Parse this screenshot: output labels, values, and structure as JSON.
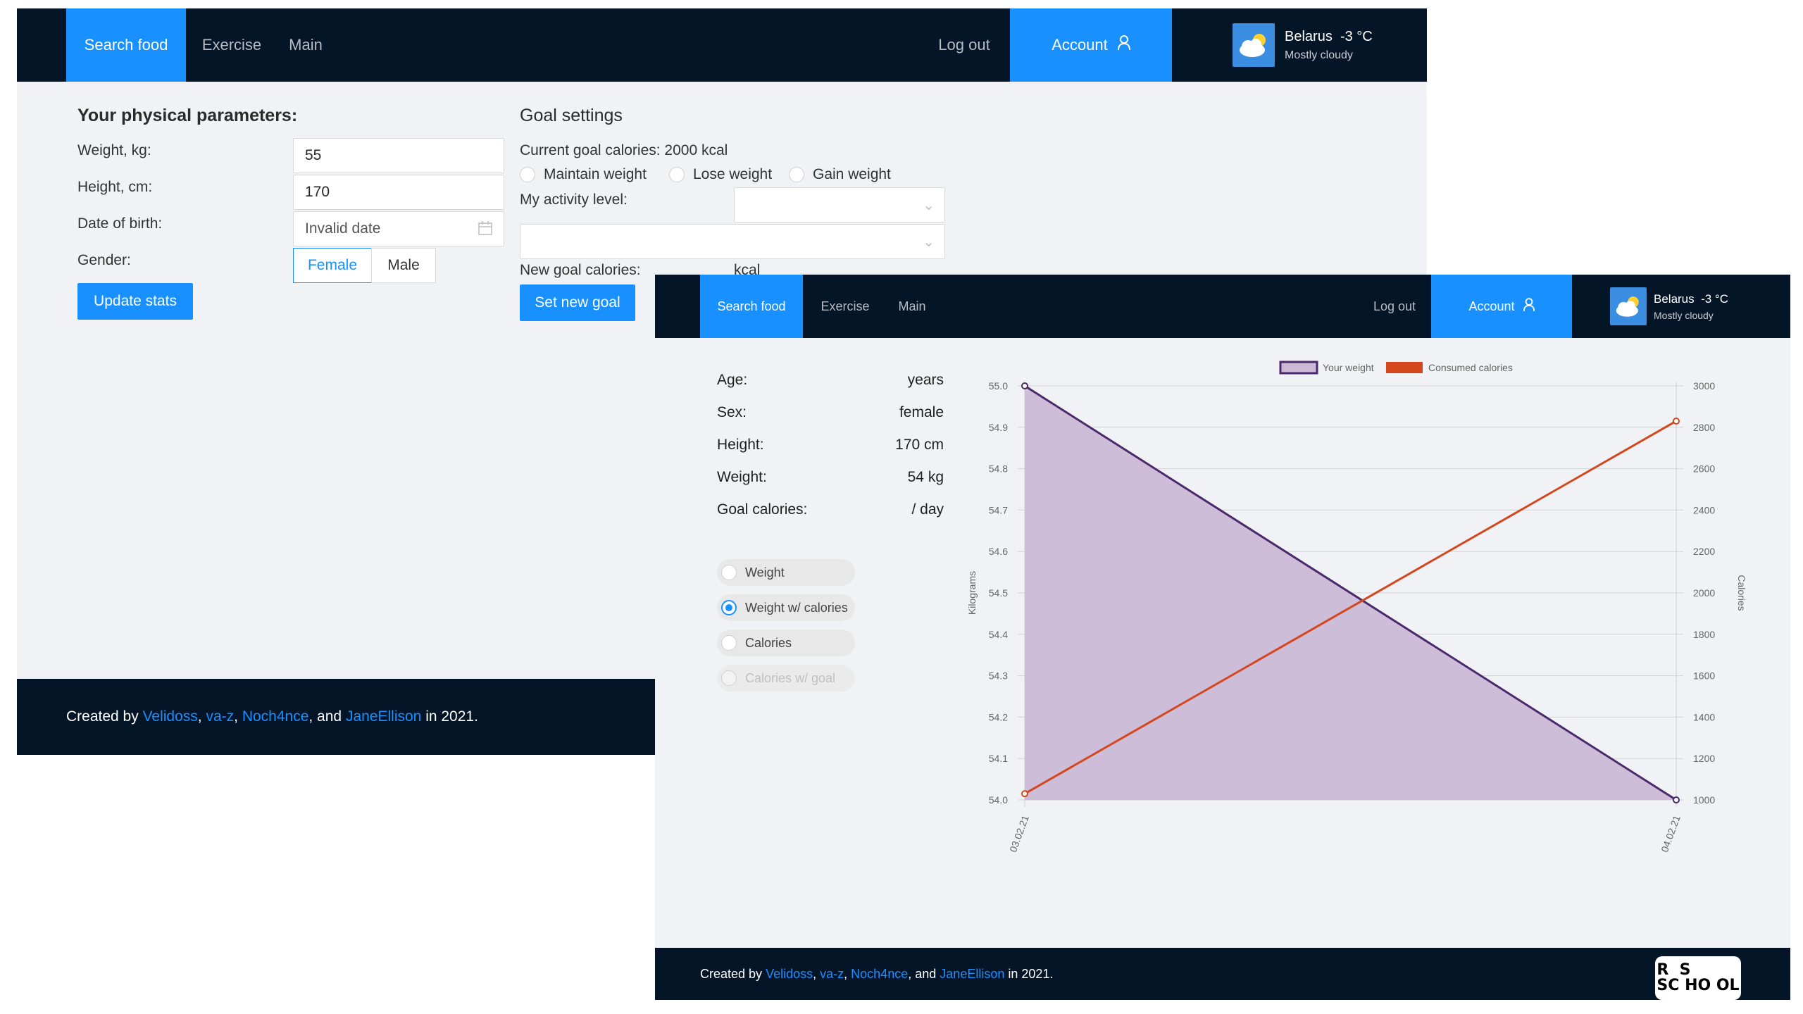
{
  "nav": {
    "search_food": "Search food",
    "exercise": "Exercise",
    "main": "Main",
    "logout": "Log out",
    "account": "Account",
    "weather_city": "Belarus",
    "weather_temp": "-3 °C",
    "weather_desc": "Mostly cloudy"
  },
  "physical": {
    "title": "Your physical parameters:",
    "weight_label": "Weight, kg:",
    "weight_value": "55",
    "height_label": "Height, cm:",
    "height_value": "170",
    "dob_label": "Date of birth:",
    "dob_value": "Invalid date",
    "gender_label": "Gender:",
    "gender_female": "Female",
    "gender_male": "Male",
    "update_button": "Update stats"
  },
  "goal": {
    "title": "Goal settings",
    "current": "Current goal calories: 2000 kcal",
    "maintain": "Maintain weight",
    "lose": "Lose weight",
    "gain": "Gain weight",
    "activity_label": "My activity level:",
    "new_goal_label": "New goal calories:",
    "kcal": "kcal",
    "set_button": "Set new goal"
  },
  "footer": {
    "created_by": "Created by",
    "author1": "Velidoss",
    "author2": "va-z",
    "author3": "Noch4nce",
    "and": ", and",
    "author4": "JaneEllison",
    "year": "in 2021.",
    "logo_line1": "R  S",
    "logo_line2": "SC HO OL"
  },
  "stats": {
    "age_label": "Age:",
    "age_value": "years",
    "sex_label": "Sex:",
    "sex_value": "female",
    "height_label": "Height:",
    "height_value": "170 cm",
    "weight_label": "Weight:",
    "weight_value": "54 kg",
    "goal_label": "Goal calories:",
    "goal_value": "/ day"
  },
  "chart_options": [
    "Weight",
    "Weight w/ calories",
    "Calories",
    "Calories w/ goal"
  ],
  "chart_selected": "Weight w/ calories",
  "chart_data": {
    "type": "line",
    "x": [
      "03.02.21",
      "04.02.21"
    ],
    "series": [
      {
        "name": "Your weight",
        "values": [
          55.0,
          54.0
        ],
        "axis": "left",
        "color": "#4a2a6a",
        "fill": "#cbb9d6"
      },
      {
        "name": "Consumed calories",
        "values": [
          1030,
          2830
        ],
        "axis": "right",
        "color": "#d4461c"
      }
    ],
    "ylabel": "Kilograms",
    "y2label": "Calories",
    "ylim": [
      54.0,
      55.0
    ],
    "y2lim": [
      1000,
      3000
    ],
    "yticks": [
      "55.0",
      "54.9",
      "54.8",
      "54.7",
      "54.6",
      "54.5",
      "54.4",
      "54.3",
      "54.2",
      "54.1",
      "54.0"
    ],
    "y2ticks": [
      "3000",
      "2800",
      "2600",
      "2400",
      "2200",
      "2000",
      "1800",
      "1600",
      "1400",
      "1200",
      "1000"
    ],
    "grid": true,
    "legend": "top"
  }
}
